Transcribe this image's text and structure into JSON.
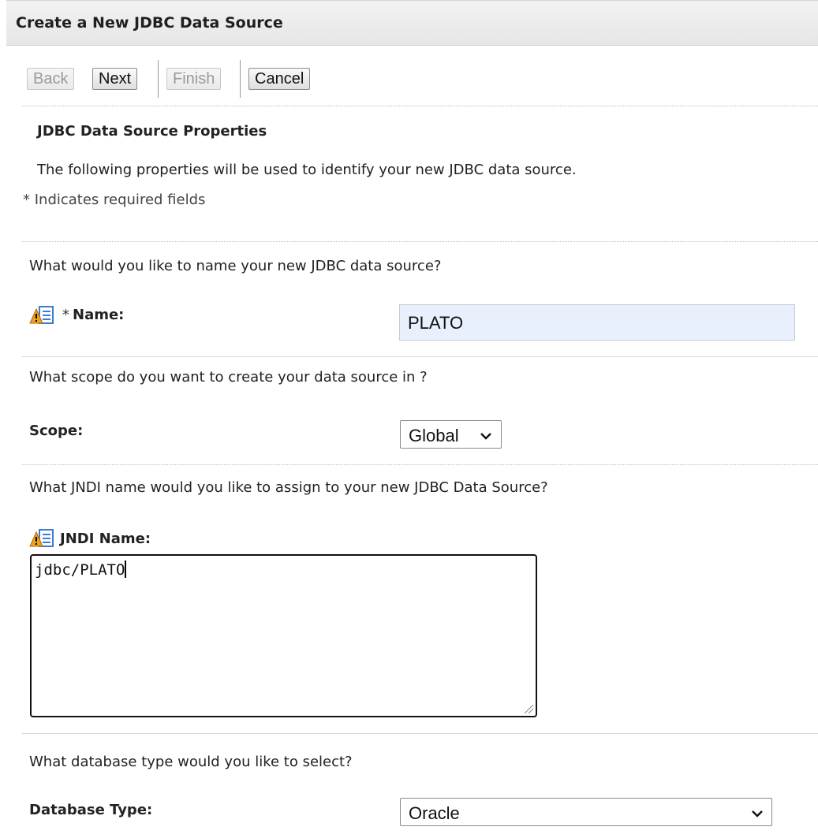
{
  "title": "Create a New JDBC Data Source",
  "toolbar": {
    "back": "Back",
    "next": "Next",
    "finish": "Finish",
    "cancel": "Cancel"
  },
  "section": {
    "heading": "JDBC Data Source Properties",
    "description": "The following properties will be used to identify your new JDBC data source.",
    "required_note": "* Indicates required fields"
  },
  "name_field": {
    "question": "What would you like to name your new JDBC data source?",
    "required_mark": "*",
    "label": "Name:",
    "value": "PLATO"
  },
  "scope_field": {
    "question": "What scope do you want to create your data source in ?",
    "label": "Scope:",
    "selected": "Global"
  },
  "jndi_field": {
    "question": "What JNDI name would you like to assign to your new JDBC Data Source?",
    "label": "JNDI Name:",
    "value": "jdbc/PLATO"
  },
  "dbtype_field": {
    "question": "What database type would you like to select?",
    "label": "Database Type:",
    "selected": "Oracle"
  },
  "icons": {
    "field_help": "warning-list-icon",
    "dropdown": "chevron-down-icon",
    "resize": "resize-grip-icon"
  },
  "colors": {
    "autofill_bg": "#e8f0fe",
    "warning": "#f0a020",
    "list_icon": "#3a7bd5"
  }
}
